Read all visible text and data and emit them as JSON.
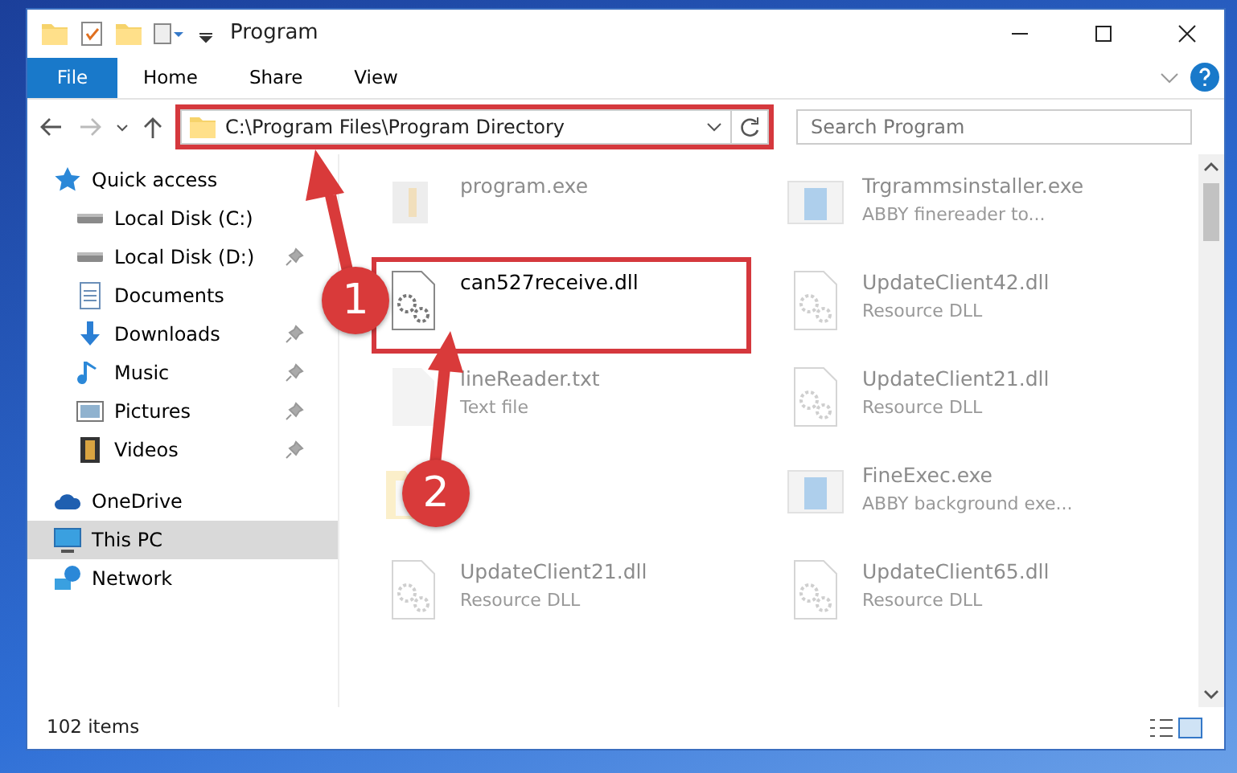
{
  "window": {
    "title": "Program"
  },
  "ribbon_tabs": [
    {
      "label": "File",
      "kind": "menu",
      "selected": false
    },
    {
      "label": "Home",
      "kind": "tab",
      "selected": false
    },
    {
      "label": "Share",
      "kind": "tab",
      "selected": false
    },
    {
      "label": "View",
      "kind": "tab",
      "selected": false
    }
  ],
  "address": {
    "path": "C:\\Program Files\\Program Directory",
    "highlighted": true
  },
  "search": {
    "placeholder": "Search Program"
  },
  "sidebar": {
    "items": [
      {
        "label": "Quick access",
        "kind": "star",
        "pinned": false,
        "selected": false
      },
      {
        "label": "Local Disk (C:)",
        "kind": "drive",
        "pinned": false,
        "selected": false
      },
      {
        "label": "Local Disk (D:)",
        "kind": "drive",
        "pinned": true,
        "selected": false
      },
      {
        "label": "Documents",
        "kind": "document",
        "pinned": false,
        "selected": false
      },
      {
        "label": "Downloads",
        "kind": "download",
        "pinned": true,
        "selected": false
      },
      {
        "label": "Music",
        "kind": "music",
        "pinned": true,
        "selected": false
      },
      {
        "label": "Pictures",
        "kind": "picture",
        "pinned": true,
        "selected": false
      },
      {
        "label": "Videos",
        "kind": "video",
        "pinned": true,
        "selected": false
      },
      {
        "label": "OneDrive",
        "kind": "cloud",
        "pinned": false,
        "selected": false
      },
      {
        "label": "This PC",
        "kind": "pc",
        "pinned": false,
        "selected": true
      },
      {
        "label": "Network",
        "kind": "network",
        "pinned": false,
        "selected": false
      }
    ]
  },
  "files": [
    {
      "name": "program.exe",
      "kind": "app",
      "dimmed": true,
      "highlighted": false
    },
    {
      "name": "Trgrammsinstaller.exe",
      "type": "ABBY finereader to...",
      "kind": "window",
      "dimmed": true,
      "highlighted": false
    },
    {
      "name": "can527receive.dll",
      "kind": "dll",
      "dimmed": false,
      "highlighted": true
    },
    {
      "name": "UpdateClient42.dll",
      "type": "Resource DLL",
      "kind": "dll",
      "dimmed": true,
      "highlighted": false
    },
    {
      "name": "lineReader.txt",
      "type": "Text file",
      "kind": "text",
      "dimmed": true,
      "highlighted": false
    },
    {
      "name": "UpdateClient21.dll",
      "type": "Resource DLL",
      "kind": "dll",
      "dimmed": true,
      "highlighted": false
    },
    {
      "kind": "folder",
      "dimmed": true,
      "highlighted": false
    },
    {
      "name": "FineExec.exe",
      "type": "ABBY background exe...",
      "kind": "window",
      "dimmed": true,
      "highlighted": false
    },
    {
      "name": "UpdateClient21.dll",
      "type": "Resource DLL",
      "kind": "dll",
      "dimmed": true,
      "highlighted": false
    },
    {
      "name": "UpdateClient65.dll",
      "type": "Resource DLL",
      "kind": "dll",
      "dimmed": true,
      "highlighted": false
    }
  ],
  "status_bar": {
    "count": "102 items"
  },
  "annotations": [
    {
      "label": "1"
    },
    {
      "label": "2"
    }
  ]
}
